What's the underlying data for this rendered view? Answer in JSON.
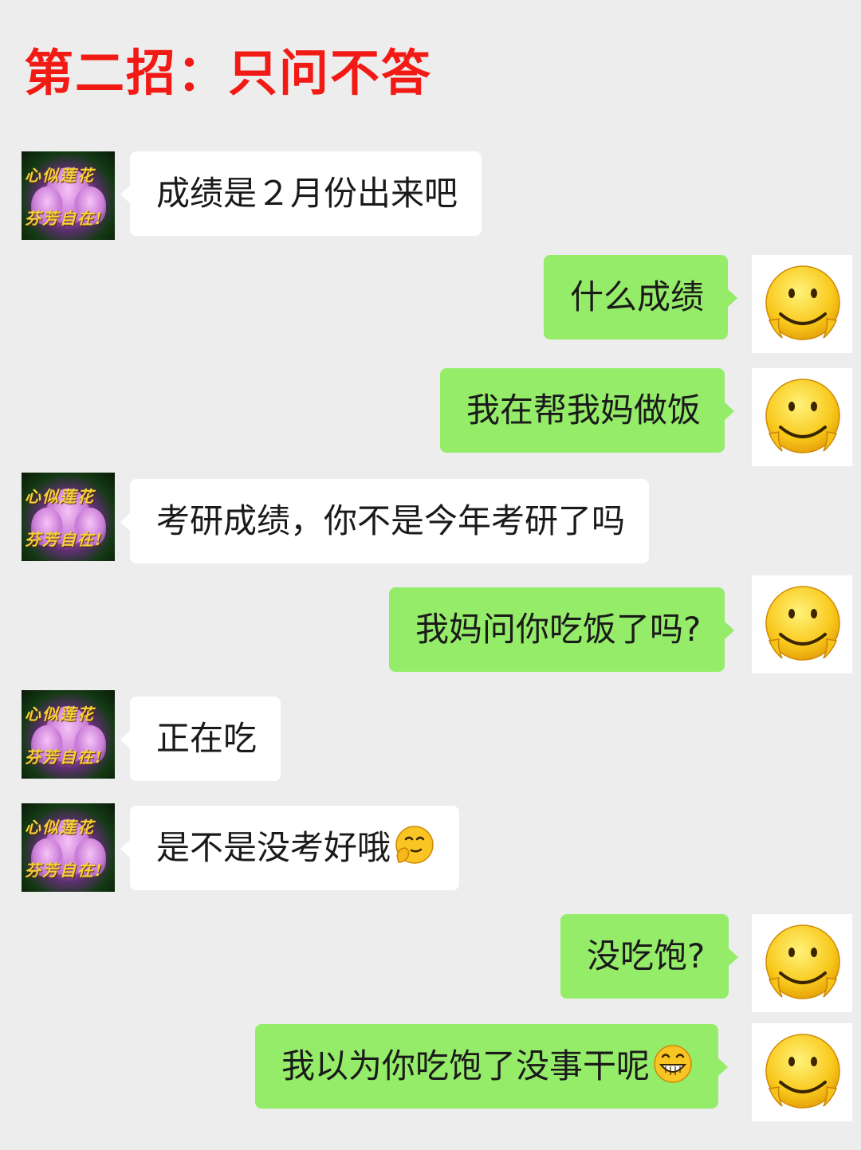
{
  "title": "第二招：只问不答",
  "contact": {
    "avatar_caption_line1": "心似莲花",
    "avatar_caption_line2": "芬芳自在!"
  },
  "messages": [
    {
      "side": "left",
      "text": "成绩是２月份出来吧"
    },
    {
      "side": "right",
      "text": "什么成绩"
    },
    {
      "side": "right",
      "text": "我在帮我妈做饭"
    },
    {
      "side": "left",
      "text": "考研成绩，你不是今年考研了吗"
    },
    {
      "side": "right",
      "text": "我妈问你吃饭了吗?"
    },
    {
      "side": "left",
      "text": "正在吃"
    },
    {
      "side": "left",
      "text": "是不是没考好哦",
      "emoji": "smirk-hand-emoji-icon"
    },
    {
      "side": "right",
      "text": "没吃饱?"
    },
    {
      "side": "right",
      "text": "我以为你吃饱了没事干呢",
      "emoji": "grin-emoji-icon"
    }
  ],
  "colors": {
    "background": "#ededed",
    "sent_bubble": "#95ec69",
    "received_bubble": "#ffffff",
    "title": "#f21a14"
  }
}
